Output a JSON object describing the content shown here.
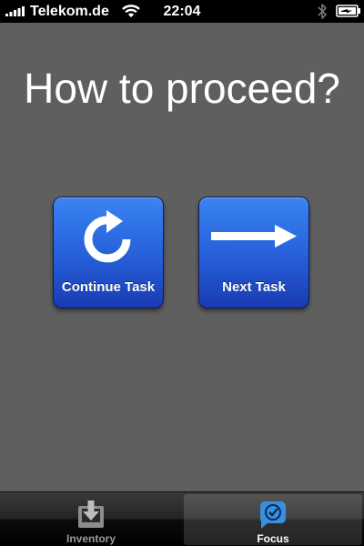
{
  "status_bar": {
    "carrier": "Telekom.de",
    "time": "22:04",
    "signal_icon": "signal-bars-icon",
    "wifi_icon": "wifi-icon",
    "bluetooth_icon": "bluetooth-icon",
    "battery_icon": "battery-charging-icon"
  },
  "main": {
    "title": "How to proceed?",
    "background_color": "#5f5f5f",
    "actions": [
      {
        "label": "Continue Task",
        "icon": "refresh-arrow-icon"
      },
      {
        "label": "Next Task",
        "icon": "arrow-right-icon"
      }
    ],
    "button_color": "#2762dc"
  },
  "tab_bar": {
    "tabs": [
      {
        "label": "Inventory",
        "icon": "inbox-download-icon",
        "selected": false
      },
      {
        "label": "Focus",
        "icon": "focus-checkmark-bubble-icon",
        "selected": true
      }
    ],
    "accent_color": "#3a8fe0"
  }
}
